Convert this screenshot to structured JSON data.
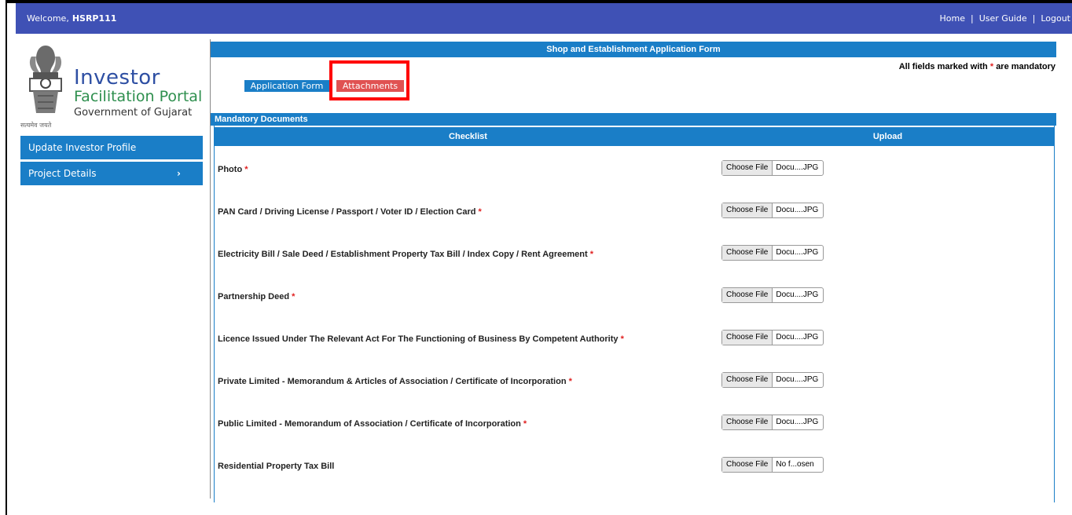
{
  "header": {
    "welcome_label": "Welcome,",
    "username": "HSRP111",
    "links": {
      "home": "Home",
      "user_guide": "User Guide",
      "logout": "Logout"
    },
    "separator": "|"
  },
  "logo": {
    "line1": "Investor",
    "line2": "Facilitation Portal",
    "line3": "Government of Gujarat",
    "motto": "सत्यमेव जयते"
  },
  "sidebar": {
    "items": [
      {
        "label": "Update Investor Profile"
      },
      {
        "label": "Project Details",
        "chevron": "›"
      }
    ]
  },
  "form": {
    "title": "Shop and Establishment Application Form",
    "mandatory_note_pre": "All fields marked with",
    "mandatory_note_star": "*",
    "mandatory_note_post": "are mandatory",
    "tabs": {
      "application": "Application Form",
      "attachments": "Attachments"
    },
    "section_title": "Mandatory Documents",
    "columns": {
      "checklist": "Checklist",
      "upload": "Upload"
    },
    "required_marker": "*",
    "documents": [
      {
        "label": "Photo",
        "required": true,
        "button": "Choose File",
        "file": "Docu....JPG"
      },
      {
        "label": "PAN Card / Driving License / Passport / Voter ID / Election Card",
        "required": true,
        "button": "Choose File",
        "file": "Docu....JPG"
      },
      {
        "label": "Electricity Bill / Sale Deed / Establishment Property Tax Bill / Index Copy / Rent Agreement",
        "required": true,
        "button": "Choose File",
        "file": "Docu....JPG"
      },
      {
        "label": "Partnership Deed",
        "required": true,
        "button": "Choose File",
        "file": "Docu....JPG"
      },
      {
        "label": "Licence Issued Under The Relevant Act For The Functioning of Business By Competent Authority",
        "required": true,
        "button": "Choose File",
        "file": "Docu....JPG"
      },
      {
        "label": "Private Limited - Memorandum & Articles of Association / Certificate of Incorporation",
        "required": true,
        "button": "Choose File",
        "file": "Docu....JPG"
      },
      {
        "label": "Public Limited - Memorandum of Association / Certificate of Incorporation",
        "required": true,
        "button": "Choose File",
        "file": "Docu....JPG"
      },
      {
        "label": "Residential Property Tax Bill",
        "required": false,
        "button": "Choose File",
        "file": "No f...osen"
      }
    ]
  },
  "colors": {
    "header_bg": "#3f51b5",
    "accent_blue": "#1a7ec7",
    "tab_active": "#e05252",
    "required": "#e02020",
    "highlight": "#ff0000"
  }
}
